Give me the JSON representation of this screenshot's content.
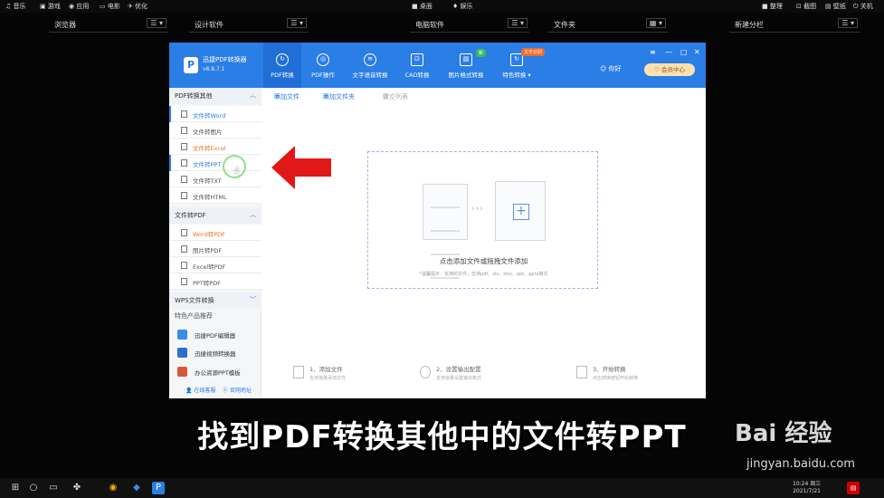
{
  "topbar": {
    "left_items": [
      "音乐",
      "游戏",
      "应用",
      "电影",
      "优化"
    ],
    "center_items": [
      "桌面",
      "娱乐"
    ],
    "right_items": [
      "整理",
      "截图",
      "壁纸",
      "关机"
    ]
  },
  "categories": [
    {
      "label": "浏览器",
      "ctl": "☰ ▾"
    },
    {
      "label": "设计软件",
      "ctl": "☰ ▾"
    },
    {
      "label": "电脑软件",
      "ctl": "☰ ▾"
    },
    {
      "label": "文件夹",
      "ctl": "▦ ▾"
    },
    {
      "label": "新建分栏",
      "ctl": "☰ ▾"
    }
  ],
  "app": {
    "name": "迅捷PDF转换器",
    "version": "v8.8.7.1",
    "tabs": [
      {
        "label": "PDF转换",
        "icon": "↻"
      },
      {
        "label": "PDF操作",
        "icon": "◎"
      },
      {
        "label": "文字语音转换",
        "icon": "≋"
      },
      {
        "label": "CAD转换",
        "icon": "⊡"
      },
      {
        "label": "图片格式转换",
        "icon": "▨"
      },
      {
        "label": "特色转换 ▾",
        "icon": "↻"
      }
    ],
    "badge_new": "新",
    "badge_ocr": "文字识别",
    "user_greeting": "你好",
    "vip_label": "♡ 会员中心",
    "window_controls": [
      "≡",
      "—",
      "□",
      "✕"
    ]
  },
  "sidebar": {
    "section1": "PDF转换其他",
    "section1_items": [
      "文件转Word",
      "文件转图片",
      "文件转Excel",
      "文件转PPT",
      "文件转TXT",
      "文件转HTML"
    ],
    "section2": "文件转PDF",
    "section2_items": [
      "Word转PDF",
      "图片转PDF",
      "Excel转PDF",
      "PPT转PDF"
    ],
    "section3": "WPS文件转换",
    "section4": "特色产品推荐",
    "products": [
      "迅捷PDF编辑器",
      "迅捷视频转换器",
      "办公资源PPT模板"
    ],
    "footer_service": "在线客服",
    "footer_site": "官网地址"
  },
  "toolbar": {
    "add_file": "添加文件",
    "add_folder": "添加文件夹",
    "clear_list": "清空列表"
  },
  "dropzone": {
    "main_text": "点击添加文件或拖拽文件添加",
    "sub_text": "*温馨提示：支持的文件，支持pdf、xls、xlsx、ppt、pptx格式"
  },
  "steps": [
    {
      "title": "1、添加文件",
      "desc": "支持批量添加文件"
    },
    {
      "title": "2、设置输出配置",
      "desc": "支持批量设置输出格式"
    },
    {
      "title": "3、开始转换",
      "desc": "点击转换按钮开始转换"
    }
  ],
  "subtitle": "找到PDF转换其他中的文件转PPT",
  "watermark": {
    "logo": "Bai 经验",
    "url": "jingyan.baidu.com"
  },
  "taskbar": {
    "time": "10:24 周三",
    "date": "2021/7/21"
  }
}
